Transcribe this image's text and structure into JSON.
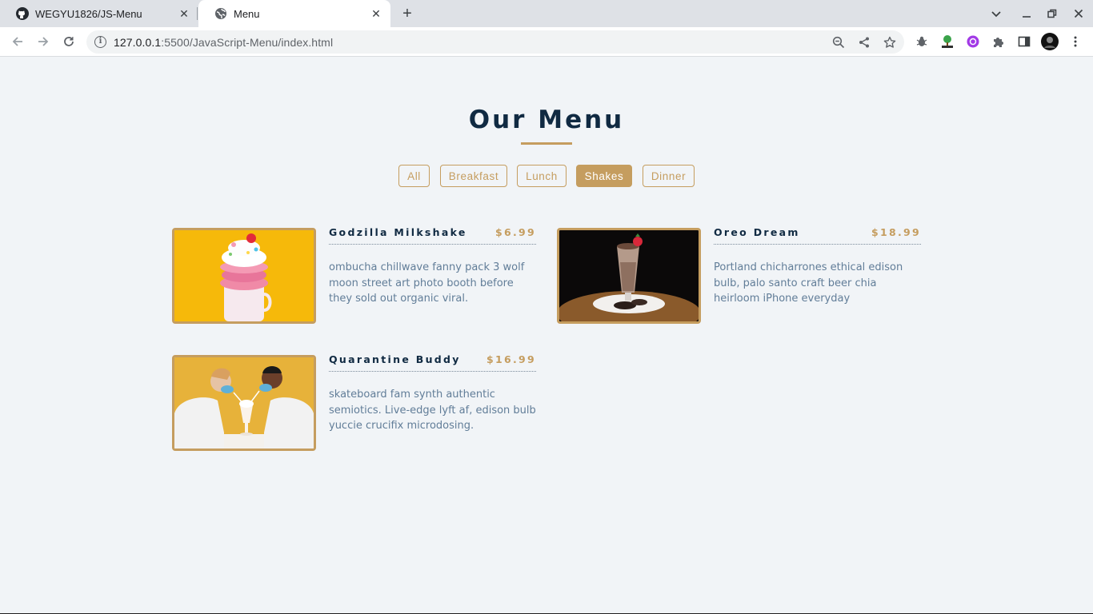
{
  "browser": {
    "tabs": [
      {
        "title": "WEGYU1826/JS-Menu",
        "icon": "github-icon"
      },
      {
        "title": "Menu",
        "icon": "globe-icon",
        "active": true
      }
    ],
    "url_host": "127.0.0.1",
    "url_rest": ":5500/JavaScript-Menu/index.html"
  },
  "page": {
    "title": "Our Menu",
    "accent_color": "#c59d5f",
    "title_color": "#102a42",
    "filters": [
      {
        "label": "All",
        "active": false
      },
      {
        "label": "Breakfast",
        "active": false
      },
      {
        "label": "Lunch",
        "active": false
      },
      {
        "label": "Shakes",
        "active": true
      },
      {
        "label": "Dinner",
        "active": false
      }
    ],
    "items": [
      {
        "name": "Godzilla Milkshake",
        "price": "$6.99",
        "desc": "ombucha chillwave fanny pack 3 wolf moon street art photo booth before they sold out organic viral.",
        "image": "milkshake-photo"
      },
      {
        "name": "Oreo Dream",
        "price": "$18.99",
        "desc": "Portland chicharrones ethical edison bulb, palo santo craft beer chia heirloom iPhone everyday",
        "image": "oreo-shake-photo"
      },
      {
        "name": "Quarantine Buddy",
        "price": "$16.99",
        "desc": "skateboard fam synth authentic semiotics. Live-edge lyft af, edison bulb yuccie crucifix microdosing.",
        "image": "couple-sharing-shake-photo"
      }
    ]
  }
}
